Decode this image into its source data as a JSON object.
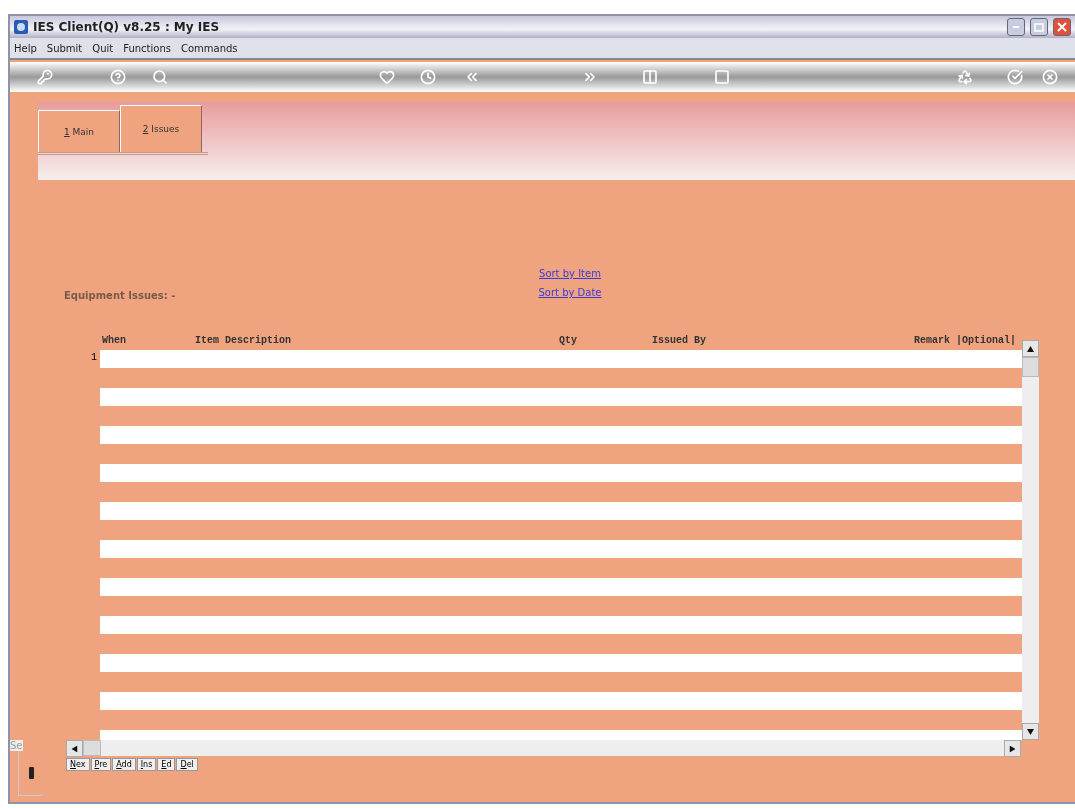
{
  "window": {
    "title": "IES Client(Q) v8.25 : My IES"
  },
  "menu": [
    "Help",
    "Submit",
    "Quit",
    "Functions",
    "Commands"
  ],
  "tabs": [
    {
      "label": "1 Main",
      "selected": false
    },
    {
      "label": "2 Issues",
      "selected": true
    }
  ],
  "sort_links": [
    "Sort by Item",
    "Sort by Date"
  ],
  "section_label": "Equipment Issues: -",
  "table": {
    "columns": [
      "When",
      "Item Description",
      "Qty",
      "Issued By",
      "Remark |Optional|"
    ],
    "rows": [
      {
        "number": "1"
      },
      {},
      {},
      {},
      {},
      {},
      {},
      {},
      {},
      {},
      {}
    ]
  },
  "nav_buttons": [
    "Nex",
    "Pre",
    "Add",
    "Ins",
    "Ed",
    "Del"
  ],
  "side_label": "Se"
}
